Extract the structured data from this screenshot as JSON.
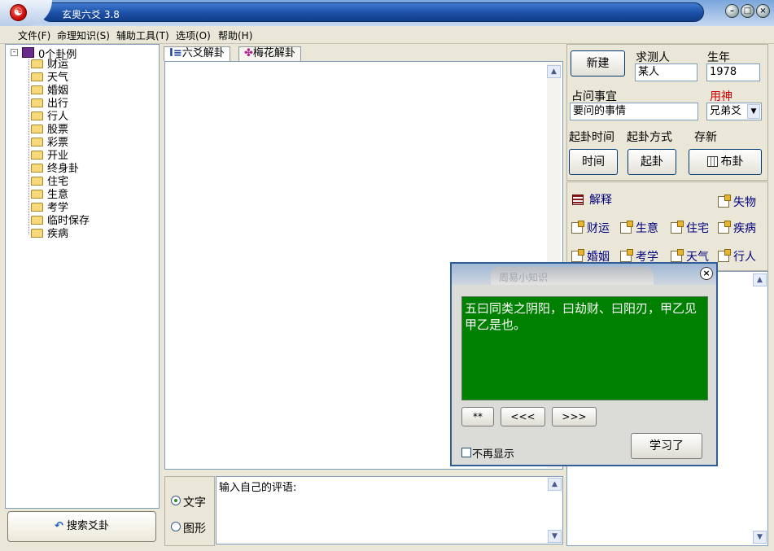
{
  "app": {
    "title": "玄奥六爻 3.8",
    "icon": "☯",
    "icon_name": "yin-yang-icon"
  },
  "window_buttons": {
    "minimize": "–",
    "maximize": "□",
    "close": "×"
  },
  "menu": [
    "文件(F)",
    "命理知识(S)",
    "辅助工具(T)",
    "选项(O)",
    "帮助(H)"
  ],
  "tree": {
    "root": "0个卦例",
    "items": [
      "财运",
      "天气",
      "婚姻",
      "出行",
      "行人",
      "股票",
      "彩票",
      "开业",
      "终身卦",
      "住宅",
      "生意",
      "考学",
      "临时保存",
      "疾病"
    ]
  },
  "search_button": "搜索爻卦",
  "tabs": [
    {
      "label": "六爻解卦",
      "active": true
    },
    {
      "label": "梅花解卦",
      "active": false
    }
  ],
  "mode": {
    "options": [
      "文字",
      "图形"
    ],
    "selected": "文字"
  },
  "comment": {
    "placeholder": "输入自己的评语:"
  },
  "form": {
    "new_button": "新建",
    "person_label": "求测人",
    "person_value": "某人",
    "birth_year_label": "生年",
    "birth_year_value": "1978",
    "matter_label": "占问事宜",
    "matter_value": "要问的事情",
    "yongshen_label": "用神",
    "yongshen_value": "兄弟爻",
    "time_label": "起卦时间",
    "method_label": "起卦方式",
    "save_label": "存新",
    "time_button": "时间",
    "start_button": "起卦",
    "layout_button": "布卦"
  },
  "links": {
    "explain": "解释",
    "lost": "失物",
    "row1": [
      "财运",
      "生意",
      "住宅",
      "疾病"
    ],
    "row2": [
      "婚姻",
      "考学",
      "天气",
      "行人"
    ]
  },
  "popup": {
    "title": "周易小知识",
    "text": "五曰同类之阴阳，曰劫财、曰阳刃，甲乙见甲乙是也。",
    "buttons": [
      "**",
      "<<<",
      ">>>"
    ],
    "dont_show": "不再显示",
    "learned_button": "学习了"
  },
  "colors": {
    "popup_text_bg": "#008000",
    "link": "#000080",
    "yongshen_label": "#cc0000"
  }
}
